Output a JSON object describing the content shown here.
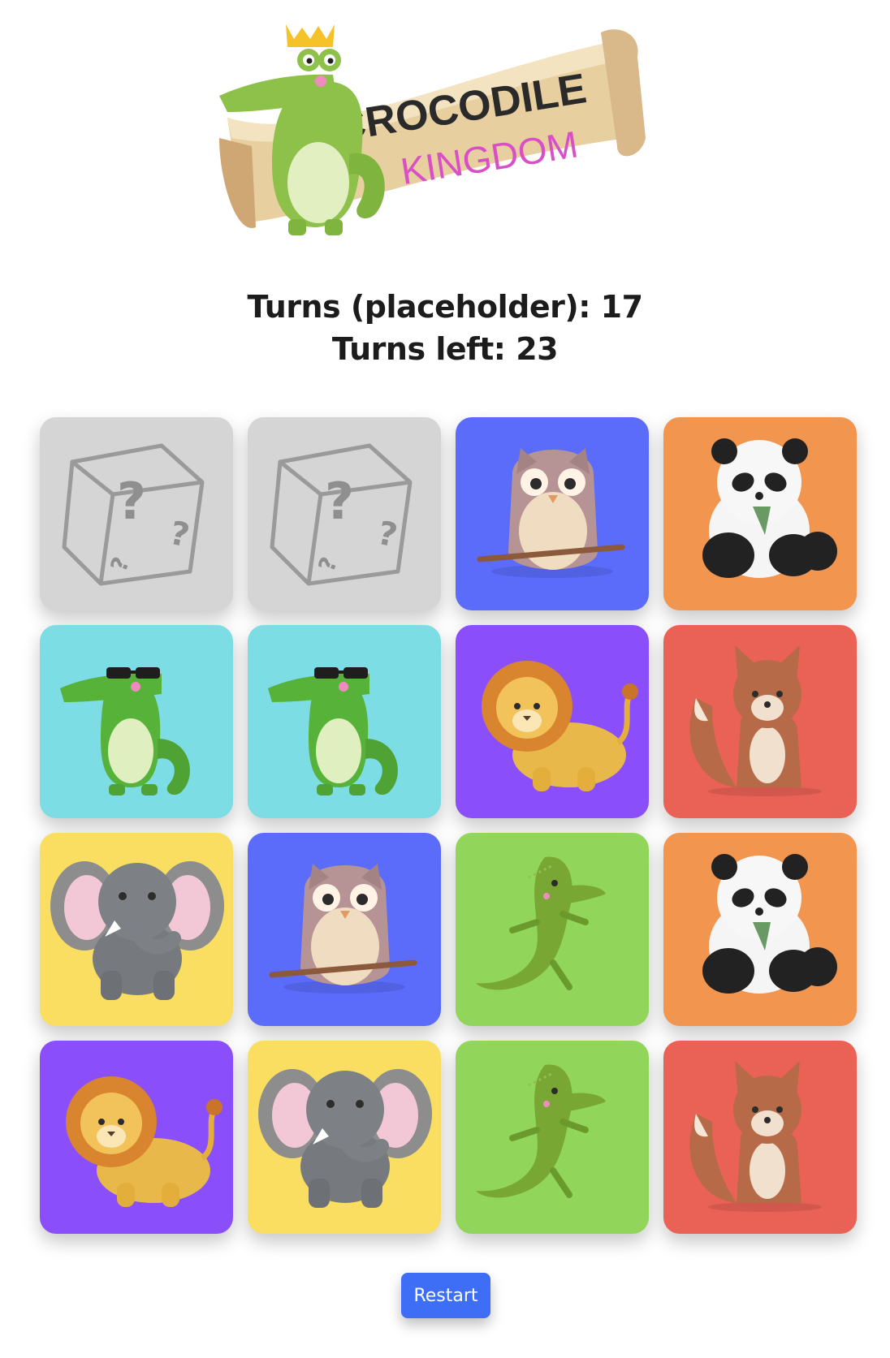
{
  "logo": {
    "line1": "CROCODILE",
    "line2": "KINGDOM"
  },
  "counters": {
    "turns": "Turns (placeholder): 17",
    "turns_left": "Turns left: 23"
  },
  "restart_label": "Restart",
  "colors": {
    "hidden": "#d5d5d5",
    "owl": "#5b6cfb",
    "panda": "#f2954e",
    "crocodile": "#7ddde5",
    "lion": "#8a4ffb",
    "fox": "#ea6155",
    "elephant": "#fade62",
    "lizard": "#91d65b",
    "button": "#3d6ef5"
  },
  "cards": [
    {
      "state": "hidden",
      "animal": "question-dice"
    },
    {
      "state": "hidden",
      "animal": "question-dice"
    },
    {
      "state": "revealed",
      "animal": "owl"
    },
    {
      "state": "revealed",
      "animal": "panda"
    },
    {
      "state": "revealed",
      "animal": "crocodile"
    },
    {
      "state": "revealed",
      "animal": "crocodile"
    },
    {
      "state": "revealed",
      "animal": "lion"
    },
    {
      "state": "revealed",
      "animal": "fox"
    },
    {
      "state": "revealed",
      "animal": "elephant"
    },
    {
      "state": "revealed",
      "animal": "owl"
    },
    {
      "state": "revealed",
      "animal": "lizard"
    },
    {
      "state": "revealed",
      "animal": "panda"
    },
    {
      "state": "revealed",
      "animal": "lion"
    },
    {
      "state": "revealed",
      "animal": "elephant"
    },
    {
      "state": "revealed",
      "animal": "lizard"
    },
    {
      "state": "revealed",
      "animal": "fox"
    }
  ]
}
